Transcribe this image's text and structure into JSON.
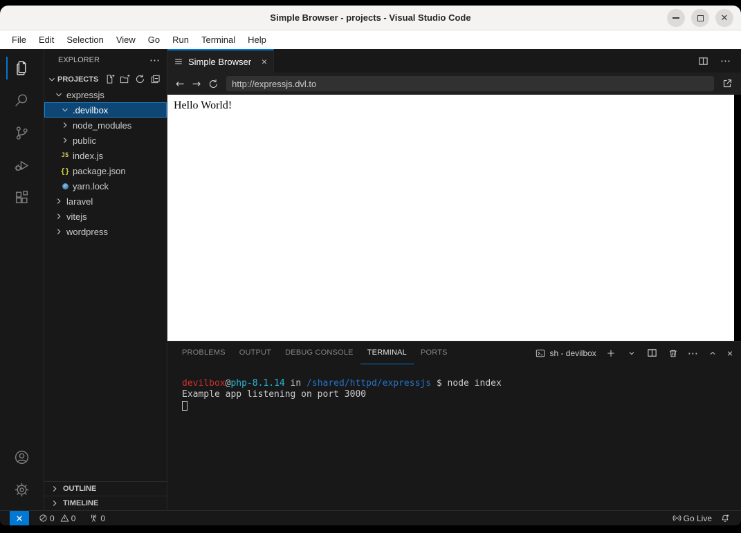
{
  "window": {
    "title": "Simple Browser - projects - Visual Studio Code"
  },
  "menu": {
    "items": [
      "File",
      "Edit",
      "Selection",
      "View",
      "Go",
      "Run",
      "Terminal",
      "Help"
    ]
  },
  "activity_bar": {
    "items": [
      {
        "name": "explorer",
        "active": true
      },
      {
        "name": "search",
        "active": false
      },
      {
        "name": "source-control",
        "active": false
      },
      {
        "name": "run-and-debug",
        "active": false
      },
      {
        "name": "extensions",
        "active": false
      }
    ],
    "bottom": [
      {
        "name": "accounts"
      },
      {
        "name": "settings"
      }
    ]
  },
  "sidebar": {
    "title": "EXPLORER",
    "section": {
      "label": "PROJECTS",
      "actions": [
        "new-file",
        "new-folder",
        "refresh",
        "collapse-all"
      ]
    },
    "tree": [
      {
        "label": "expressjs",
        "kind": "folder",
        "state": "expanded",
        "depth": 0
      },
      {
        "label": ".devilbox",
        "kind": "folder",
        "state": "expanded",
        "depth": 1,
        "selected": true
      },
      {
        "label": "node_modules",
        "kind": "folder",
        "state": "collapsed",
        "depth": 1
      },
      {
        "label": "public",
        "kind": "folder",
        "state": "collapsed",
        "depth": 1
      },
      {
        "label": "index.js",
        "kind": "file",
        "icon": "js",
        "depth": 1
      },
      {
        "label": "package.json",
        "kind": "file",
        "icon": "json",
        "depth": 1
      },
      {
        "label": "yarn.lock",
        "kind": "file",
        "icon": "yarn",
        "depth": 1
      },
      {
        "label": "laravel",
        "kind": "folder",
        "state": "collapsed",
        "depth": 0
      },
      {
        "label": "vitejs",
        "kind": "folder",
        "state": "collapsed",
        "depth": 0
      },
      {
        "label": "wordpress",
        "kind": "folder",
        "state": "collapsed",
        "depth": 0
      }
    ],
    "bottom_sections": [
      {
        "label": "OUTLINE"
      },
      {
        "label": "TIMELINE"
      }
    ]
  },
  "editor": {
    "tab": {
      "label": "Simple Browser",
      "icon": "list-flat-icon"
    },
    "browser": {
      "url": "http://expressjs.dvl.to",
      "page_text": "Hello World!"
    }
  },
  "panel": {
    "tabs": [
      {
        "label": "PROBLEMS",
        "active": false
      },
      {
        "label": "OUTPUT",
        "active": false
      },
      {
        "label": "DEBUG CONSOLE",
        "active": false
      },
      {
        "label": "TERMINAL",
        "active": true
      },
      {
        "label": "PORTS",
        "active": false
      }
    ],
    "terminal_profile": "sh - devilbox",
    "terminal": {
      "prompt_user": "devilbox",
      "prompt_at": "@",
      "prompt_host": "php-8.1.14",
      "prompt_sep": " in ",
      "prompt_path": "/shared/httpd/expressjs",
      "prompt_cmd": " $ node index",
      "output_line": "Example app listening on port 3000"
    }
  },
  "status_bar": {
    "errors": "0",
    "warnings": "0",
    "ports": "0",
    "go_live": "Go Live"
  },
  "colors": {
    "accent": "#0078d4",
    "selection_bg": "#0e4775",
    "selection_border": "#1f85d6",
    "terminal_red": "#cd3131",
    "terminal_cyan": "#29b8db",
    "terminal_blue": "#2472c8",
    "titlebar_bg": "#f4f3f2",
    "ui_bg": "#181818",
    "editor_bg": "#1f1f1f"
  }
}
